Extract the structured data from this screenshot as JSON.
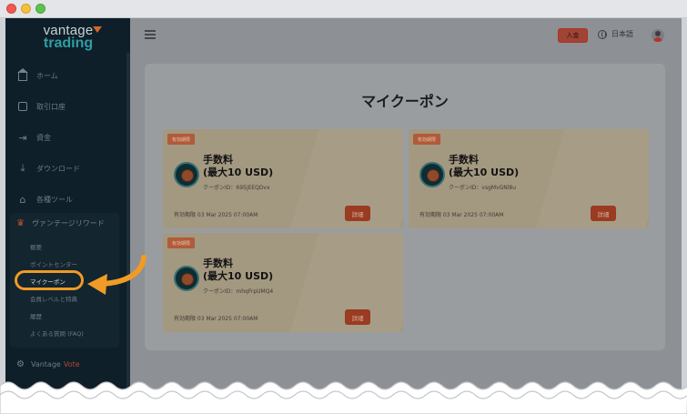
{
  "window": {
    "controls": [
      "close",
      "minimize",
      "maximize"
    ]
  },
  "logo": {
    "line1": "vantage",
    "line2": "trading"
  },
  "sidebar": {
    "items": [
      {
        "label": "ホーム",
        "icon": "home-icon"
      },
      {
        "label": "取引口座",
        "icon": "accounts-icon"
      },
      {
        "label": "資金",
        "icon": "funds-icon"
      },
      {
        "label": "ダウンロード",
        "icon": "download-icon"
      },
      {
        "label": "各種ツール",
        "icon": "tools-icon"
      }
    ],
    "rewards": {
      "label": "ヴァンテージリワード",
      "icon": "crown-icon",
      "sub_items": [
        "概要",
        "ポイントセンター",
        "マイクーポン",
        "会員レベルと特典",
        "履歴",
        "よくある質問 (FAQ)"
      ],
      "active": "マイクーポン"
    },
    "vote": {
      "label": "Vantage",
      "label_accent": "Vote",
      "icon": "vote-icon"
    }
  },
  "header": {
    "deposit_label": "入金",
    "language_label": "日本語"
  },
  "page": {
    "title": "マイクーポン"
  },
  "coupons": [
    {
      "badge": "有効期限",
      "title_line1": "手数料",
      "title_line2": "(最大10 USD)",
      "code": "クーポンID：695jEEQDvx",
      "expiry": "有効期限 03 Mar 2025 07:00AM",
      "detail_label": "詳細"
    },
    {
      "badge": "有効期限",
      "title_line1": "手数料",
      "title_line2": "(最大10 USD)",
      "code": "クーポンID：vsgMvGNl8u",
      "expiry": "有効期限 03 Mar 2025 07:00AM",
      "detail_label": "詳細"
    },
    {
      "badge": "有効期限",
      "title_line1": "手数料",
      "title_line2": "(最大10 USD)",
      "code": "クーポンID：mhqFrpUMQ4",
      "expiry": "有効期限 03 Mar 2025 07:00AM",
      "detail_label": "詳細"
    }
  ],
  "colors": {
    "sidebar_bg": "#0e1f29",
    "highlight": "#ef9b26",
    "accent": "#c0502b"
  }
}
